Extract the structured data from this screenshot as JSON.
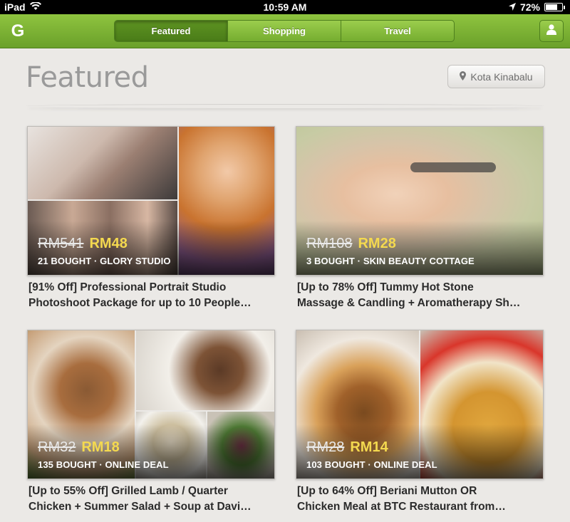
{
  "statusbar": {
    "device": "iPad",
    "time": "10:59 AM",
    "battery": "72%",
    "battery_level": 0.72
  },
  "appbar": {
    "logo": "G",
    "tabs": [
      {
        "label": "Featured",
        "active": true
      },
      {
        "label": "Shopping",
        "active": false
      },
      {
        "label": "Travel",
        "active": false
      }
    ],
    "profile_icon": "user-icon"
  },
  "page": {
    "title": "Featured",
    "location": "Kota Kinabalu"
  },
  "deals": [
    {
      "old_price": "RM541",
      "new_price": "RM48",
      "bought": "21 BOUGHT · GLORY STUDIO",
      "title_line1": "[91% Off] Professional Portrait Studio",
      "title_line2": "Photoshoot Package for up to 10 People…"
    },
    {
      "old_price": "RM108",
      "new_price": "RM28",
      "bought": "3 BOUGHT · SKIN BEAUTY COTTAGE",
      "title_line1": "[Up to 78% Off] Tummy Hot Stone",
      "title_line2": "Massage & Candling + Aromatherapy Sh…"
    },
    {
      "old_price": "RM32",
      "new_price": "RM18",
      "bought": "135 BOUGHT · ONLINE DEAL",
      "title_line1": "[Up to 55% Off] Grilled Lamb / Quarter",
      "title_line2": "Chicken + Summer Salad + Soup at Davi…"
    },
    {
      "old_price": "RM28",
      "new_price": "RM14",
      "bought": "103 BOUGHT · ONLINE DEAL",
      "title_line1": "[Up to 64% Off] Beriani Mutton OR",
      "title_line2": "Chicken Meal at BTC Restaurant from…"
    }
  ],
  "colors": {
    "brand_green": "#7bb535",
    "price_yellow": "#f4d94f"
  }
}
